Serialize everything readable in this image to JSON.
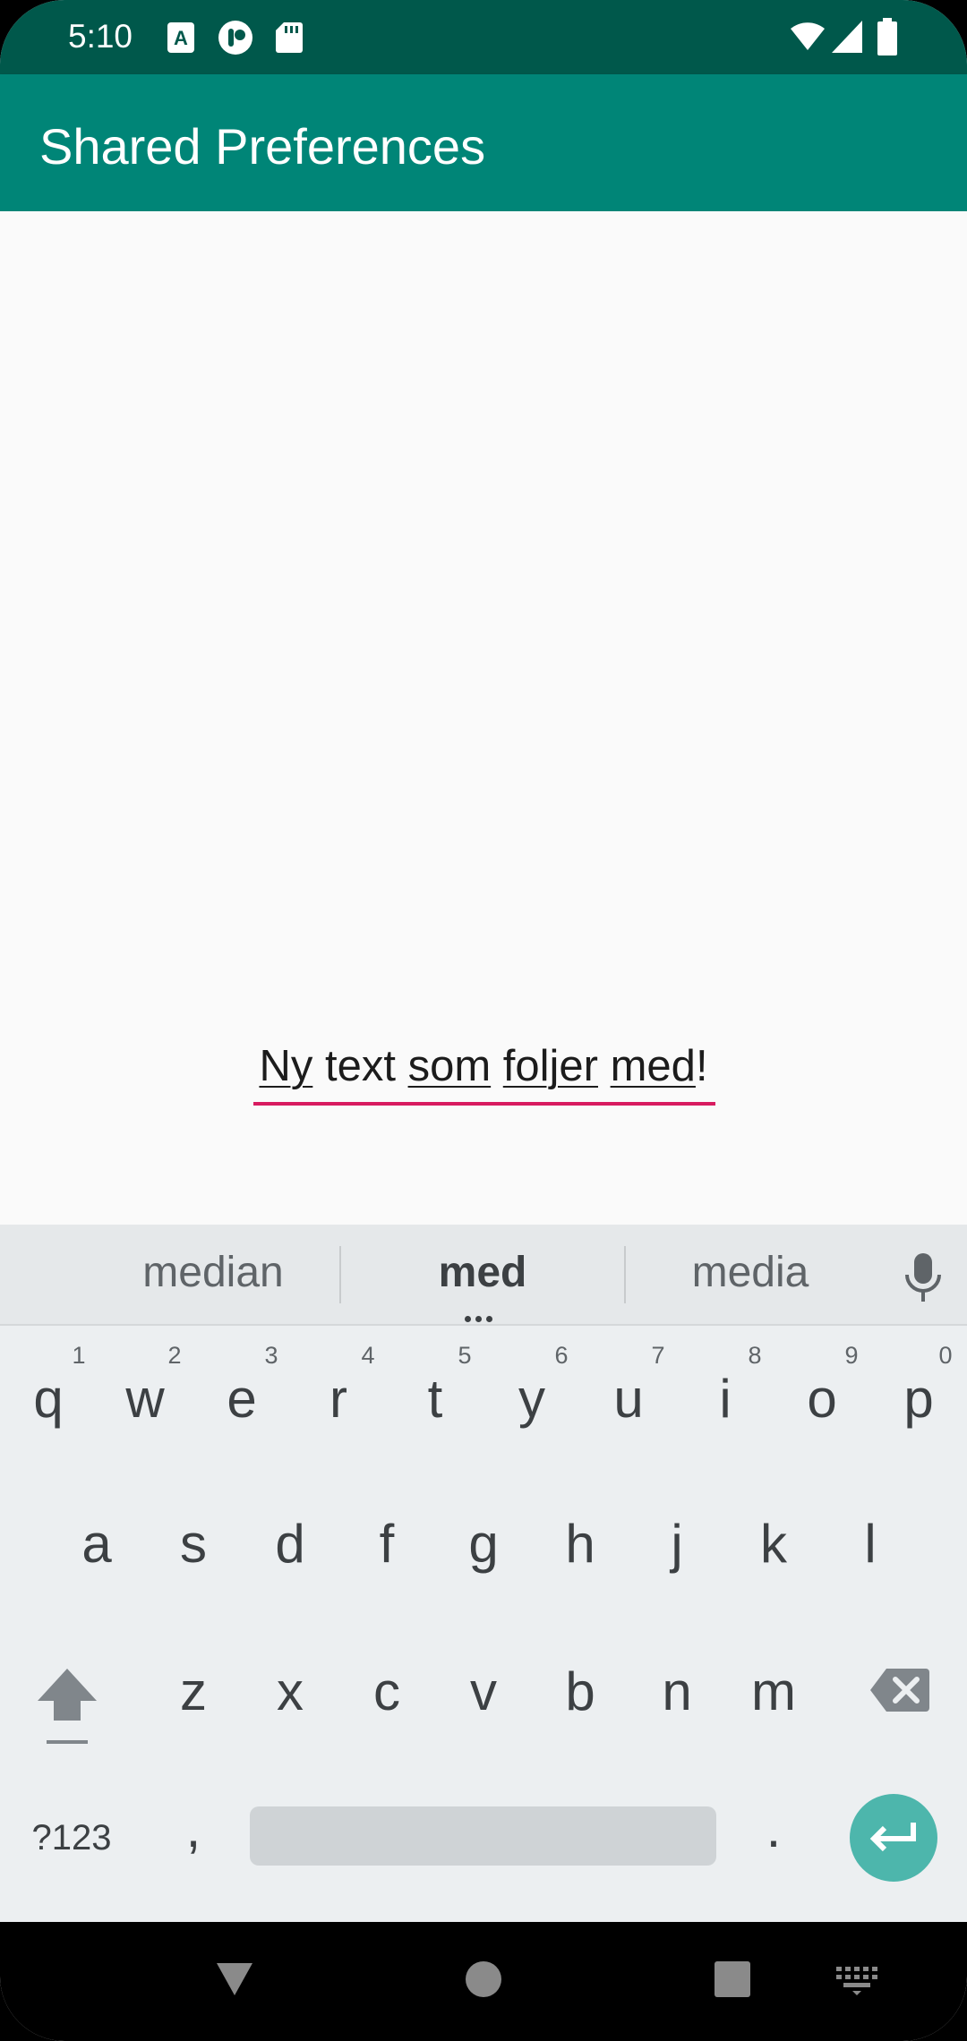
{
  "status_bar": {
    "time": "5:10",
    "left_icons": [
      "a-font-icon",
      "podcast-icon",
      "sd-card-icon"
    ],
    "right_icons": [
      "wifi-icon",
      "signal-icon",
      "battery-icon"
    ]
  },
  "app_bar": {
    "title": "Shared Preferences"
  },
  "content": {
    "text_words": [
      "Ny",
      "text",
      "som",
      "foljer",
      "med",
      "!"
    ]
  },
  "keyboard": {
    "suggestions": [
      "median",
      "med",
      "media"
    ],
    "row1": [
      {
        "key": "q",
        "hint": "1"
      },
      {
        "key": "w",
        "hint": "2"
      },
      {
        "key": "e",
        "hint": "3"
      },
      {
        "key": "r",
        "hint": "4"
      },
      {
        "key": "t",
        "hint": "5"
      },
      {
        "key": "y",
        "hint": "6"
      },
      {
        "key": "u",
        "hint": "7"
      },
      {
        "key": "i",
        "hint": "8"
      },
      {
        "key": "o",
        "hint": "9"
      },
      {
        "key": "p",
        "hint": "0"
      }
    ],
    "row2": [
      "a",
      "s",
      "d",
      "f",
      "g",
      "h",
      "j",
      "k",
      "l"
    ],
    "row3": [
      "z",
      "x",
      "c",
      "v",
      "b",
      "n",
      "m"
    ],
    "symbols_label": "?123",
    "comma": ",",
    "period": "."
  },
  "colors": {
    "status_bar": "#00584b",
    "app_bar": "#008577",
    "accent_underline": "#d81b60",
    "enter_key": "#4db6ac"
  }
}
